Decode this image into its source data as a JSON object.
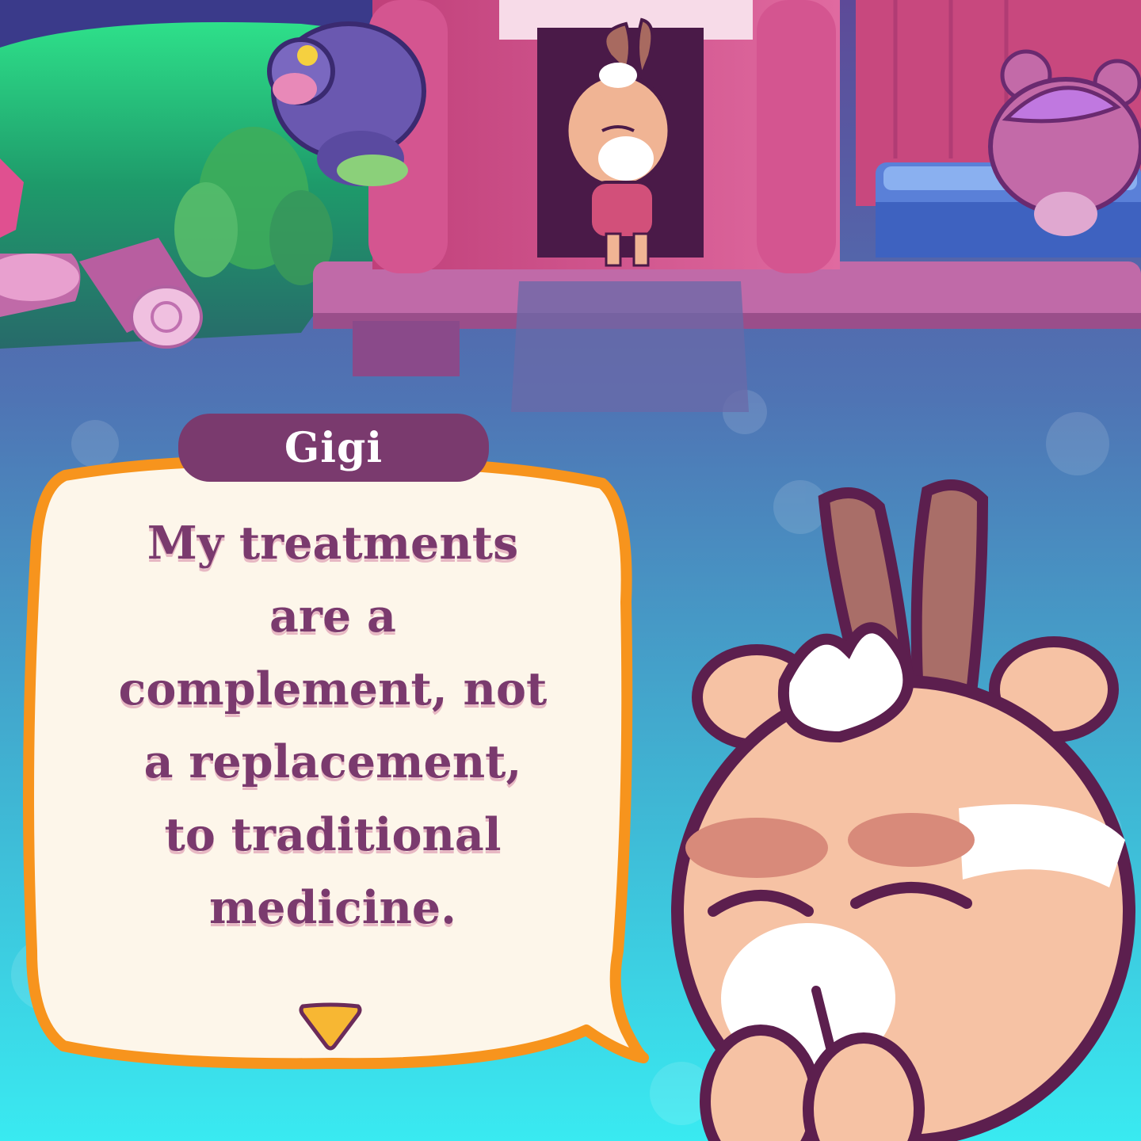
{
  "dialogue": {
    "speaker": "Gigi",
    "text": "My treatments\nare a\ncomplement, not\na replacement,\nto traditional\nmedicine."
  },
  "icons": {
    "advance": "chevron-down-icon"
  },
  "colors": {
    "bubble_border": "#f7941d",
    "bubble_fill": "#fdf6ea",
    "name_tag": "#7a3a6e",
    "dialogue_text": "#7a3a6e",
    "text_shadow": "#e7b8c3",
    "arrow": "#f7b733"
  }
}
